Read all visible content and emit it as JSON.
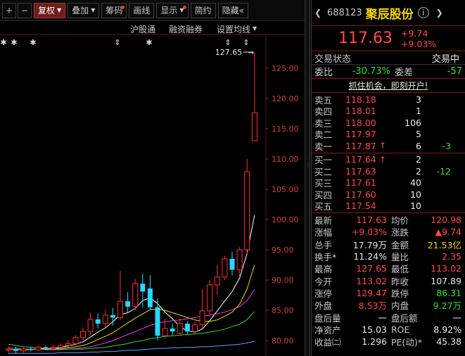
{
  "toolbar": {
    "plus_label": "+",
    "minus_label": "−",
    "items": [
      {
        "label": "复权",
        "active": true,
        "arrow": true,
        "dot": false
      },
      {
        "label": "叠加",
        "active": false,
        "arrow": true,
        "dot": false
      },
      {
        "label": "筹码",
        "active": false,
        "arrow": false,
        "dot": true
      },
      {
        "label": "画线",
        "active": false,
        "arrow": false,
        "dot": false
      },
      {
        "label": "显示",
        "active": false,
        "arrow": true,
        "dot": true
      },
      {
        "label": "简约",
        "active": false,
        "arrow": false,
        "dot": false
      },
      {
        "label": "隐藏«",
        "active": false,
        "arrow": false,
        "dot": false
      }
    ]
  },
  "chart_links": {
    "hgt": "沪股通",
    "margin": "融资融券",
    "ma_settings": "设置均线"
  },
  "chart_data": {
    "type": "candlestick",
    "y_ticks": [
      "125.00",
      "120.00",
      "115.00",
      "110.00",
      "105.00",
      "100.00",
      "95.00",
      "90.00",
      "85.00",
      "80.00"
    ],
    "ylim": [
      77.5,
      127.65
    ],
    "high_marker": "127.65",
    "candles": [
      {
        "o": 78.4,
        "c": 78.6,
        "h": 79.0,
        "l": 78.0
      },
      {
        "o": 78.6,
        "c": 78.3,
        "h": 79.0,
        "l": 77.9
      },
      {
        "o": 78.3,
        "c": 78.6,
        "h": 78.9,
        "l": 78.0
      },
      {
        "o": 78.6,
        "c": 78.5,
        "h": 79.0,
        "l": 78.2
      },
      {
        "o": 78.5,
        "c": 78.9,
        "h": 79.2,
        "l": 78.3
      },
      {
        "o": 78.9,
        "c": 78.7,
        "h": 79.2,
        "l": 78.4
      },
      {
        "o": 78.7,
        "c": 78.9,
        "h": 79.3,
        "l": 78.5
      },
      {
        "o": 78.9,
        "c": 79.2,
        "h": 79.6,
        "l": 78.6
      },
      {
        "o": 79.2,
        "c": 79.5,
        "h": 80.0,
        "l": 78.9
      },
      {
        "o": 79.5,
        "c": 80.5,
        "h": 80.9,
        "l": 79.2
      },
      {
        "o": 80.5,
        "c": 81.5,
        "h": 82.2,
        "l": 80.0
      },
      {
        "o": 81.5,
        "c": 83.5,
        "h": 84.6,
        "l": 81.0
      },
      {
        "o": 83.5,
        "c": 82.8,
        "h": 84.5,
        "l": 82.0
      },
      {
        "o": 82.8,
        "c": 84.2,
        "h": 85.0,
        "l": 82.2
      },
      {
        "o": 84.2,
        "c": 83.8,
        "h": 85.4,
        "l": 82.5
      },
      {
        "o": 83.8,
        "c": 86.5,
        "h": 91.5,
        "l": 83.4
      },
      {
        "o": 86.5,
        "c": 85.6,
        "h": 88.0,
        "l": 84.6
      },
      {
        "o": 85.6,
        "c": 89.4,
        "h": 90.2,
        "l": 85.0
      },
      {
        "o": 89.4,
        "c": 88.1,
        "h": 91.0,
        "l": 85.5
      },
      {
        "o": 88.6,
        "c": 85.5,
        "h": 90.8,
        "l": 85.0
      },
      {
        "o": 85.5,
        "c": 80.8,
        "h": 87.0,
        "l": 80.0
      },
      {
        "o": 80.8,
        "c": 82.0,
        "h": 83.6,
        "l": 80.3
      },
      {
        "o": 82.0,
        "c": 81.5,
        "h": 82.8,
        "l": 80.9
      },
      {
        "o": 81.2,
        "c": 82.8,
        "h": 83.7,
        "l": 80.8
      },
      {
        "o": 82.8,
        "c": 81.5,
        "h": 83.2,
        "l": 80.9
      },
      {
        "o": 81.5,
        "c": 82.6,
        "h": 83.1,
        "l": 81.2
      },
      {
        "o": 82.6,
        "c": 84.9,
        "h": 88.5,
        "l": 82.0
      },
      {
        "o": 84.9,
        "c": 89.2,
        "h": 90.0,
        "l": 84.0
      },
      {
        "o": 89.2,
        "c": 90.5,
        "h": 92.5,
        "l": 87.5
      },
      {
        "o": 90.5,
        "c": 93.5,
        "h": 94.0,
        "l": 90.0
      },
      {
        "o": 93.5,
        "c": 91.7,
        "h": 94.7,
        "l": 90.8
      },
      {
        "o": 91.7,
        "c": 95.0,
        "h": 95.5,
        "l": 90.6
      },
      {
        "o": 95.0,
        "c": 107.9,
        "h": 110.0,
        "l": 94.3
      },
      {
        "o": 113.0,
        "c": 117.63,
        "h": 127.65,
        "l": 113.02
      }
    ],
    "ma": [
      {
        "color": "#ffffff",
        "values": [
          78.5,
          78.5,
          78.5,
          78.5,
          78.6,
          78.7,
          78.7,
          78.9,
          79.1,
          79.4,
          79.8,
          80.6,
          81.4,
          82.1,
          83.1,
          84.3,
          84.6,
          85.3,
          86.6,
          87.1,
          86.1,
          84.7,
          83.6,
          82.3,
          81.6,
          81.4,
          81.9,
          83.3,
          84.9,
          86.5,
          88.1,
          90.3,
          94.4,
          100.7
        ]
      },
      {
        "color": "#f2d600",
        "values": [
          78.5,
          78.5,
          78.5,
          78.5,
          78.6,
          78.6,
          78.6,
          78.7,
          78.8,
          79.0,
          79.2,
          79.6,
          80.2,
          80.7,
          81.3,
          82.1,
          82.9,
          83.7,
          84.4,
          85.1,
          85.2,
          85.0,
          84.6,
          84.2,
          83.8,
          83.4,
          83.2,
          83.2,
          83.4,
          84.0,
          84.7,
          86.0,
          88.5,
          92.5
        ]
      },
      {
        "color": "#e040e0",
        "values": [
          78.8,
          78.7,
          78.6,
          78.6,
          78.6,
          78.5,
          78.5,
          78.5,
          78.6,
          78.7,
          78.8,
          79.0,
          79.3,
          79.6,
          80.0,
          80.5,
          81.0,
          81.5,
          82.0,
          82.5,
          82.9,
          83.1,
          83.3,
          83.4,
          83.6,
          83.8,
          84.0,
          84.2,
          84.4,
          84.7,
          85.1,
          85.6,
          86.6,
          88.4
        ]
      },
      {
        "color": "#3cd23c",
        "values": [
          79.4,
          79.2,
          79.0,
          78.9,
          78.8,
          78.7,
          78.6,
          78.6,
          78.6,
          78.6,
          78.6,
          78.7,
          78.8,
          78.9,
          79.1,
          79.3,
          79.5,
          79.8,
          80.0,
          80.3,
          80.5,
          80.7,
          80.8,
          80.9,
          81.0,
          81.1,
          81.2,
          81.4,
          81.6,
          81.9,
          82.3,
          82.7,
          83.5,
          84.8
        ]
      },
      {
        "color": "#5aa0ff",
        "values": [
          77.9,
          77.9,
          77.9,
          77.9,
          77.9,
          77.9,
          77.9,
          78.0,
          78.0,
          78.0,
          78.0,
          78.1,
          78.1,
          78.2,
          78.2,
          78.3,
          78.4,
          78.4,
          78.5,
          78.6,
          78.7,
          78.7,
          78.8,
          78.8,
          78.9,
          78.9,
          79.0,
          79.0,
          79.1,
          79.2,
          79.3,
          79.4,
          79.6,
          79.9
        ]
      }
    ]
  },
  "quote": {
    "code": "688123",
    "name": "聚辰股份",
    "price": "117.63",
    "change": "+9.74",
    "change_pct": "+9.03%",
    "status_label": "交易状态",
    "status_value": "交易中",
    "ratio_label": "委比",
    "ratio_value": "-30.73%",
    "diff_label": "委差",
    "diff_value": "-57",
    "promo": "抓住机会，即刻开户!",
    "asks": [
      {
        "label": "卖五",
        "price": "118.18",
        "vol": "3",
        "delta": "",
        "arrow": ""
      },
      {
        "label": "卖四",
        "price": "118.01",
        "vol": "1",
        "delta": "",
        "arrow": ""
      },
      {
        "label": "卖三",
        "price": "118.00",
        "vol": "106",
        "delta": "",
        "arrow": ""
      },
      {
        "label": "卖二",
        "price": "117.97",
        "vol": "5",
        "delta": "",
        "arrow": ""
      },
      {
        "label": "卖一",
        "price": "117.87",
        "vol": "6",
        "delta": "-3",
        "arrow": "↑"
      }
    ],
    "bids": [
      {
        "label": "买一",
        "price": "117.64",
        "vol": "2",
        "delta": "",
        "arrow": "↑"
      },
      {
        "label": "买二",
        "price": "117.63",
        "vol": "2",
        "delta": "-12",
        "arrow": ""
      },
      {
        "label": "买三",
        "price": "117.61",
        "vol": "40",
        "delta": "",
        "arrow": ""
      },
      {
        "label": "买四",
        "price": "117.60",
        "vol": "10",
        "delta": "",
        "arrow": ""
      },
      {
        "label": "买五",
        "price": "117.54",
        "vol": "10",
        "delta": "",
        "arrow": ""
      }
    ],
    "stats": [
      {
        "l1": "最新",
        "v1": "117.63",
        "c1": "red",
        "l2": "均价",
        "v2": "120.98",
        "c2": "red"
      },
      {
        "l1": "涨幅",
        "v1": "+9.03%",
        "c1": "red",
        "l2": "涨跌",
        "v2": "▲9.74",
        "c2": "red"
      },
      {
        "l1": "总手",
        "v1": "17.79万",
        "c1": "white",
        "l2": "金额",
        "v2": "21.53亿",
        "c2": "yellow"
      },
      {
        "l1": "换手*",
        "v1": "11.24%",
        "c1": "white",
        "l2": "量比",
        "v2": "2.35",
        "c2": "red"
      },
      {
        "l1": "最高",
        "v1": "127.65",
        "c1": "red",
        "l2": "最低",
        "v2": "113.02",
        "c2": "red"
      },
      {
        "l1": "今开",
        "v1": "113.02",
        "c1": "red",
        "l2": "昨收",
        "v2": "107.89",
        "c2": "white"
      },
      {
        "l1": "涨停",
        "v1": "129.47",
        "c1": "red",
        "l2": "跌停",
        "v2": "86.31",
        "c2": "green"
      },
      {
        "l1": "外盘",
        "v1": "8.53万",
        "c1": "red",
        "l2": "内盘",
        "v2": "9.27万",
        "c2": "green"
      },
      {
        "l1": "盘后量",
        "v1": "一",
        "c1": "white",
        "l2": "盘后额",
        "v2": "一",
        "c2": "white"
      },
      {
        "l1": "净资产",
        "v1": "15.03",
        "c1": "white",
        "l2": "ROE",
        "v2": "8.92%",
        "c2": "white"
      },
      {
        "l1": "收益㈡",
        "v1": "1.296",
        "c1": "white",
        "l2": "PE(动)*",
        "v2": "45.38",
        "c2": "white"
      }
    ]
  }
}
